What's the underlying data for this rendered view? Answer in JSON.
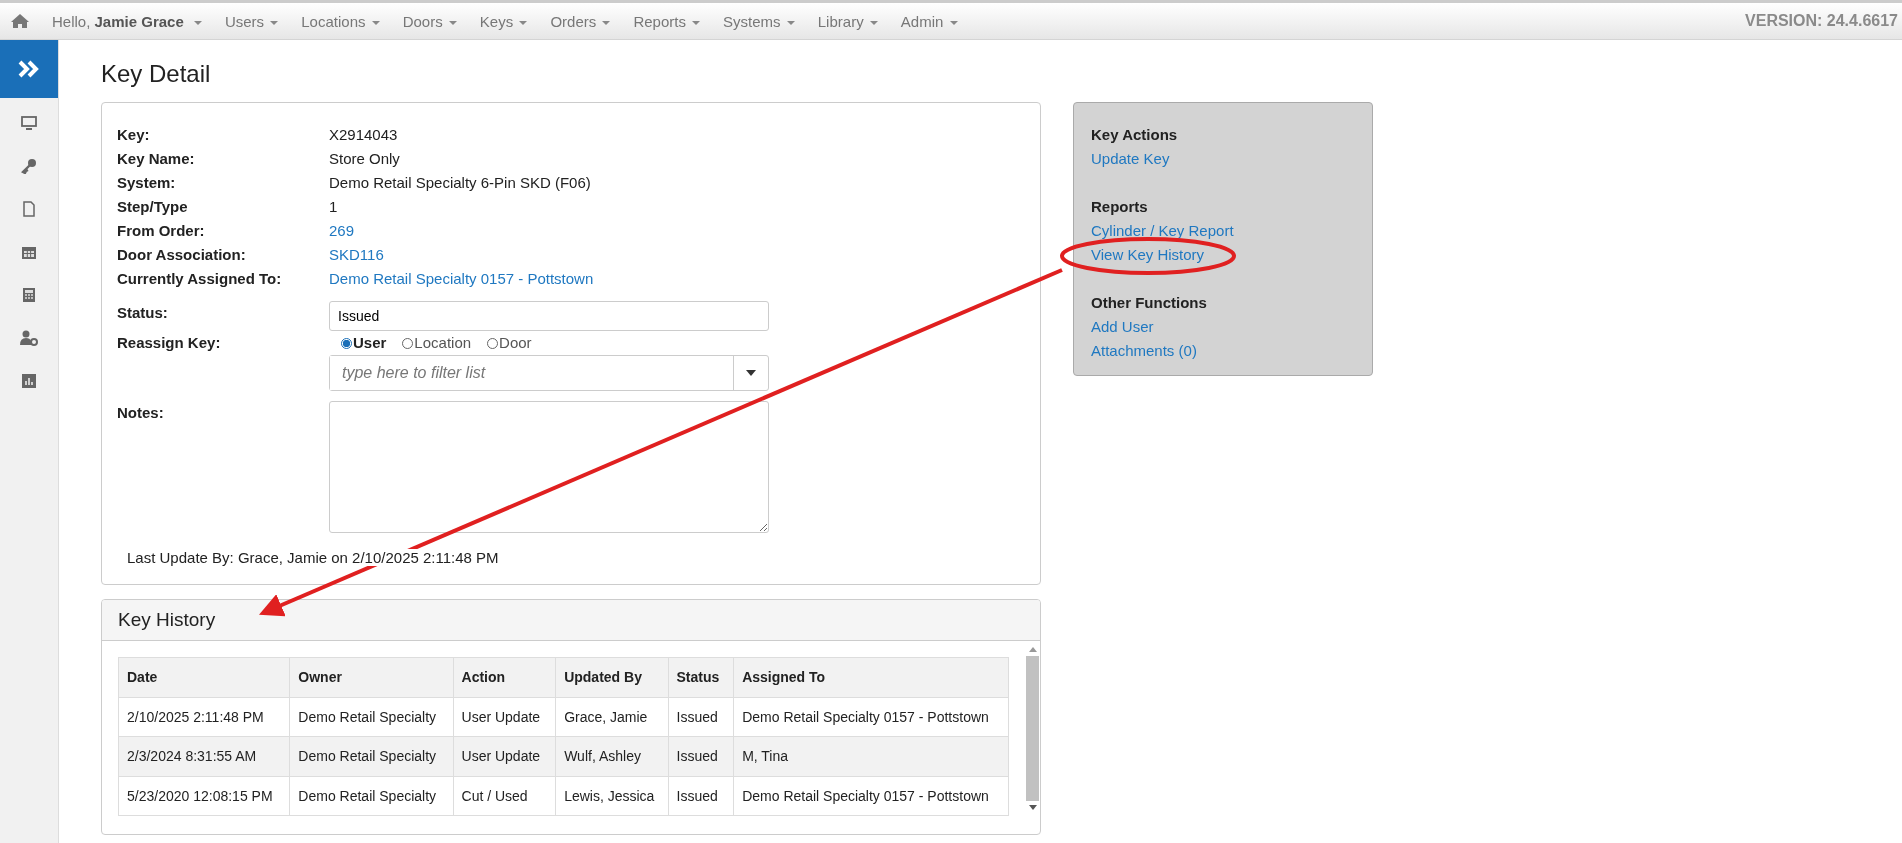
{
  "nav": {
    "greeting": "Hello,",
    "user": "Jamie Grace",
    "menus": [
      "Users",
      "Locations",
      "Doors",
      "Keys",
      "Orders",
      "Reports",
      "Systems",
      "Library",
      "Admin"
    ],
    "version": "VERSION: 24.4.6617"
  },
  "page_title": "Key Detail",
  "details": [
    {
      "label": "Key:",
      "value": "X2914043",
      "kind": "text"
    },
    {
      "label": "Key Name:",
      "value": "Store Only",
      "kind": "text"
    },
    {
      "label": "System:",
      "value": "Demo Retail Specialty 6-Pin SKD (F06)",
      "kind": "text"
    },
    {
      "label": "Step/Type",
      "value": "1",
      "kind": "text"
    },
    {
      "label": "From Order:",
      "value": "269",
      "kind": "link"
    },
    {
      "label": "Door Association:",
      "value": "SKD116",
      "kind": "link"
    },
    {
      "label": "Currently Assigned To:",
      "value": "Demo Retail Specialty 0157 - Pottstown",
      "kind": "link"
    }
  ],
  "status": {
    "label": "Status:",
    "value": "Issued"
  },
  "reassign": {
    "label": "Reassign Key:",
    "options": [
      {
        "label": "User",
        "selected": true
      },
      {
        "label": "Location",
        "selected": false
      },
      {
        "label": "Door",
        "selected": false
      }
    ],
    "placeholder": "type here to filter list"
  },
  "notes": {
    "label": "Notes:"
  },
  "last_update": "Last Update By: Grace, Jamie on 2/10/2025 2:11:48 PM",
  "actions": [
    {
      "heading": "Key Actions",
      "links": [
        "Update Key"
      ]
    },
    {
      "heading": "Reports",
      "links": [
        "Cylinder / Key Report",
        "View Key History"
      ]
    },
    {
      "heading": "Other Functions",
      "links": [
        "Add User",
        "Attachments (0)"
      ]
    }
  ],
  "key_history": {
    "title": "Key History",
    "columns": [
      "Date",
      "Owner",
      "Action",
      "Updated By",
      "Status",
      "Assigned To"
    ],
    "rows": [
      [
        "2/10/2025 2:11:48 PM",
        "Demo Retail Specialty",
        "User Update",
        "Grace, Jamie",
        "Issued",
        "Demo Retail Specialty 0157 - Pottstown"
      ],
      [
        "2/3/2024 8:31:55 AM",
        "Demo Retail Specialty",
        "User Update",
        "Wulf, Ashley",
        "Issued",
        "M, Tina"
      ],
      [
        "5/23/2020 12:08:15 PM",
        "Demo Retail Specialty",
        "Cut / Used",
        "Lewis, Jessica",
        "Issued",
        "Demo Retail Specialty 0157 - Pottstown"
      ]
    ]
  }
}
